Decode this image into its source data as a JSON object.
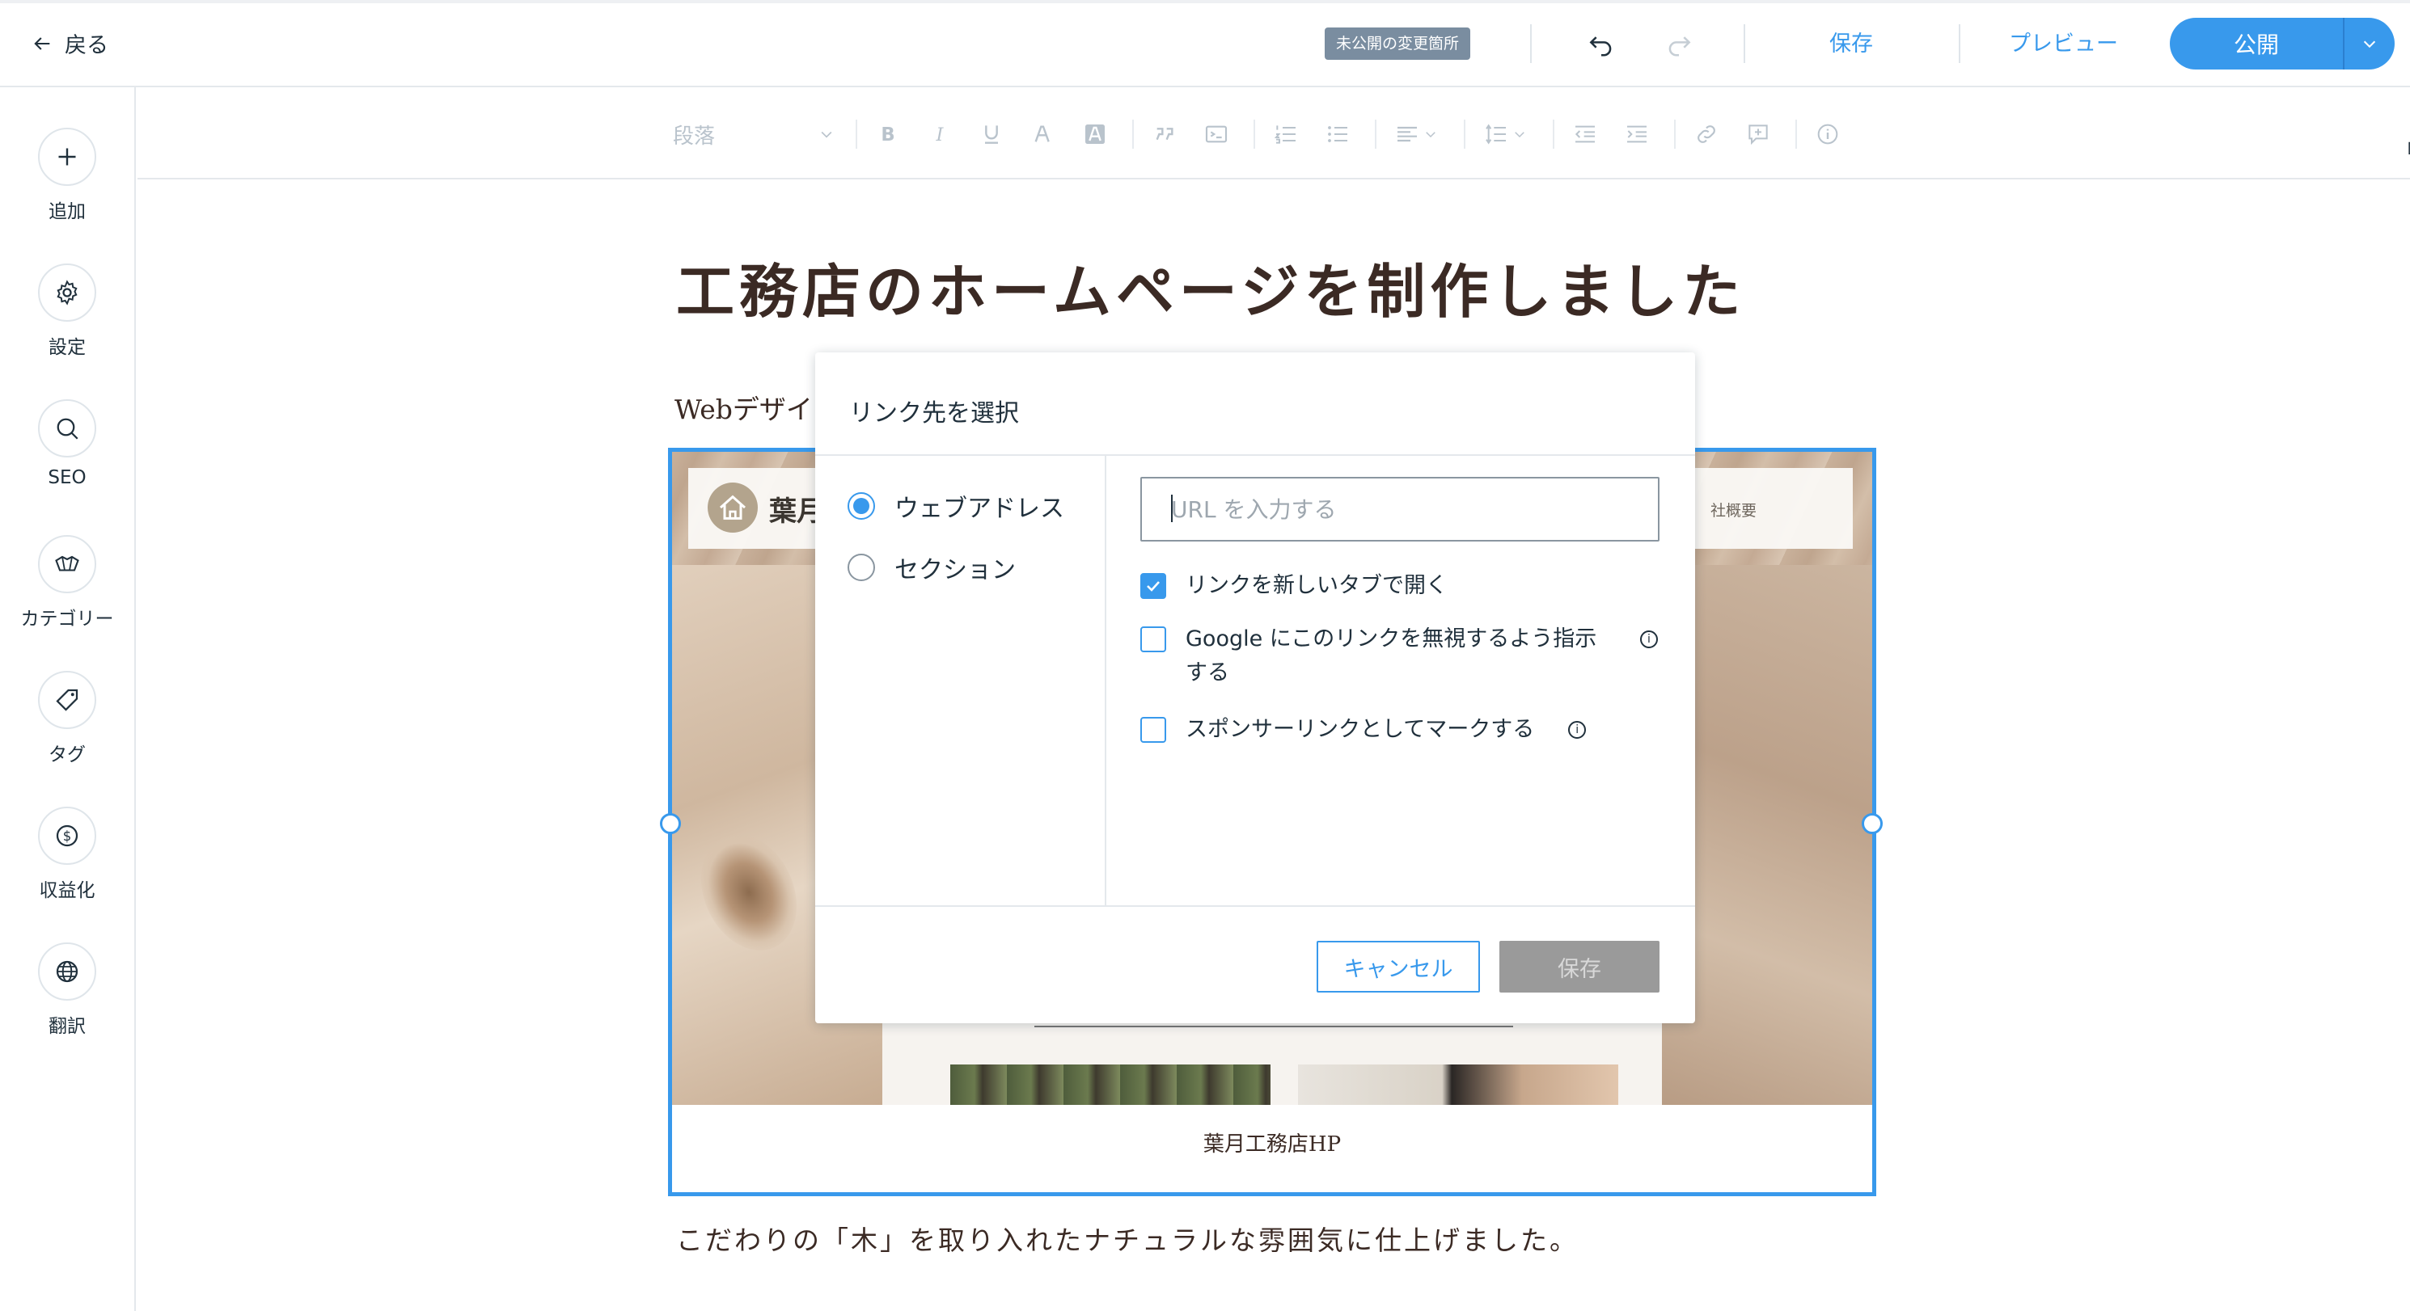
{
  "topbar": {
    "back_label": "戻る",
    "unpublished_badge": "未公開の変更箇所",
    "save_label": "保存",
    "preview_label": "プレビュー",
    "publish_label": "公開"
  },
  "sidebar": {
    "items": [
      {
        "label": "追加",
        "icon": "plus-icon"
      },
      {
        "label": "設定",
        "icon": "gear-icon"
      },
      {
        "label": "SEO",
        "icon": "search-icon"
      },
      {
        "label": "カテゴリー",
        "icon": "category-icon"
      },
      {
        "label": "タグ",
        "icon": "tag-icon"
      },
      {
        "label": "収益化",
        "icon": "dollar-icon"
      },
      {
        "label": "翻訳",
        "icon": "globe-icon"
      }
    ]
  },
  "format_toolbar": {
    "paragraph_style": "段落",
    "memo_label": "メモ"
  },
  "article": {
    "title": "工務店のホームページを制作しました",
    "lead_text": "Webデザイ",
    "image_site_name": "葉月",
    "image_nav_text": "社概要",
    "image_caption": "葉月工務店HP",
    "body_text": "こだわりの「木」を取り入れたナチュラルな雰囲気に仕上げました。"
  },
  "link_dialog": {
    "title": "リンク先を選択",
    "options": {
      "web_address": "ウェブアドレス",
      "section": "セクション"
    },
    "selected_option": "web_address",
    "url_placeholder": "URL を入力する",
    "url_value": "",
    "checkboxes": {
      "new_tab": {
        "label": "リンクを新しいタブで開く",
        "checked": true
      },
      "nofollow": {
        "label": "Google にこのリンクを無視するよう指示する",
        "checked": false
      },
      "sponsored": {
        "label": "スポンサーリンクとしてマークする",
        "checked": false
      }
    },
    "cancel_label": "キャンセル",
    "save_label": "保存"
  },
  "colors": {
    "accent": "#3899ec",
    "badge_bg": "#7a8da0",
    "disabled_button": "#9a9a9a",
    "title_text": "#3b2a24"
  }
}
